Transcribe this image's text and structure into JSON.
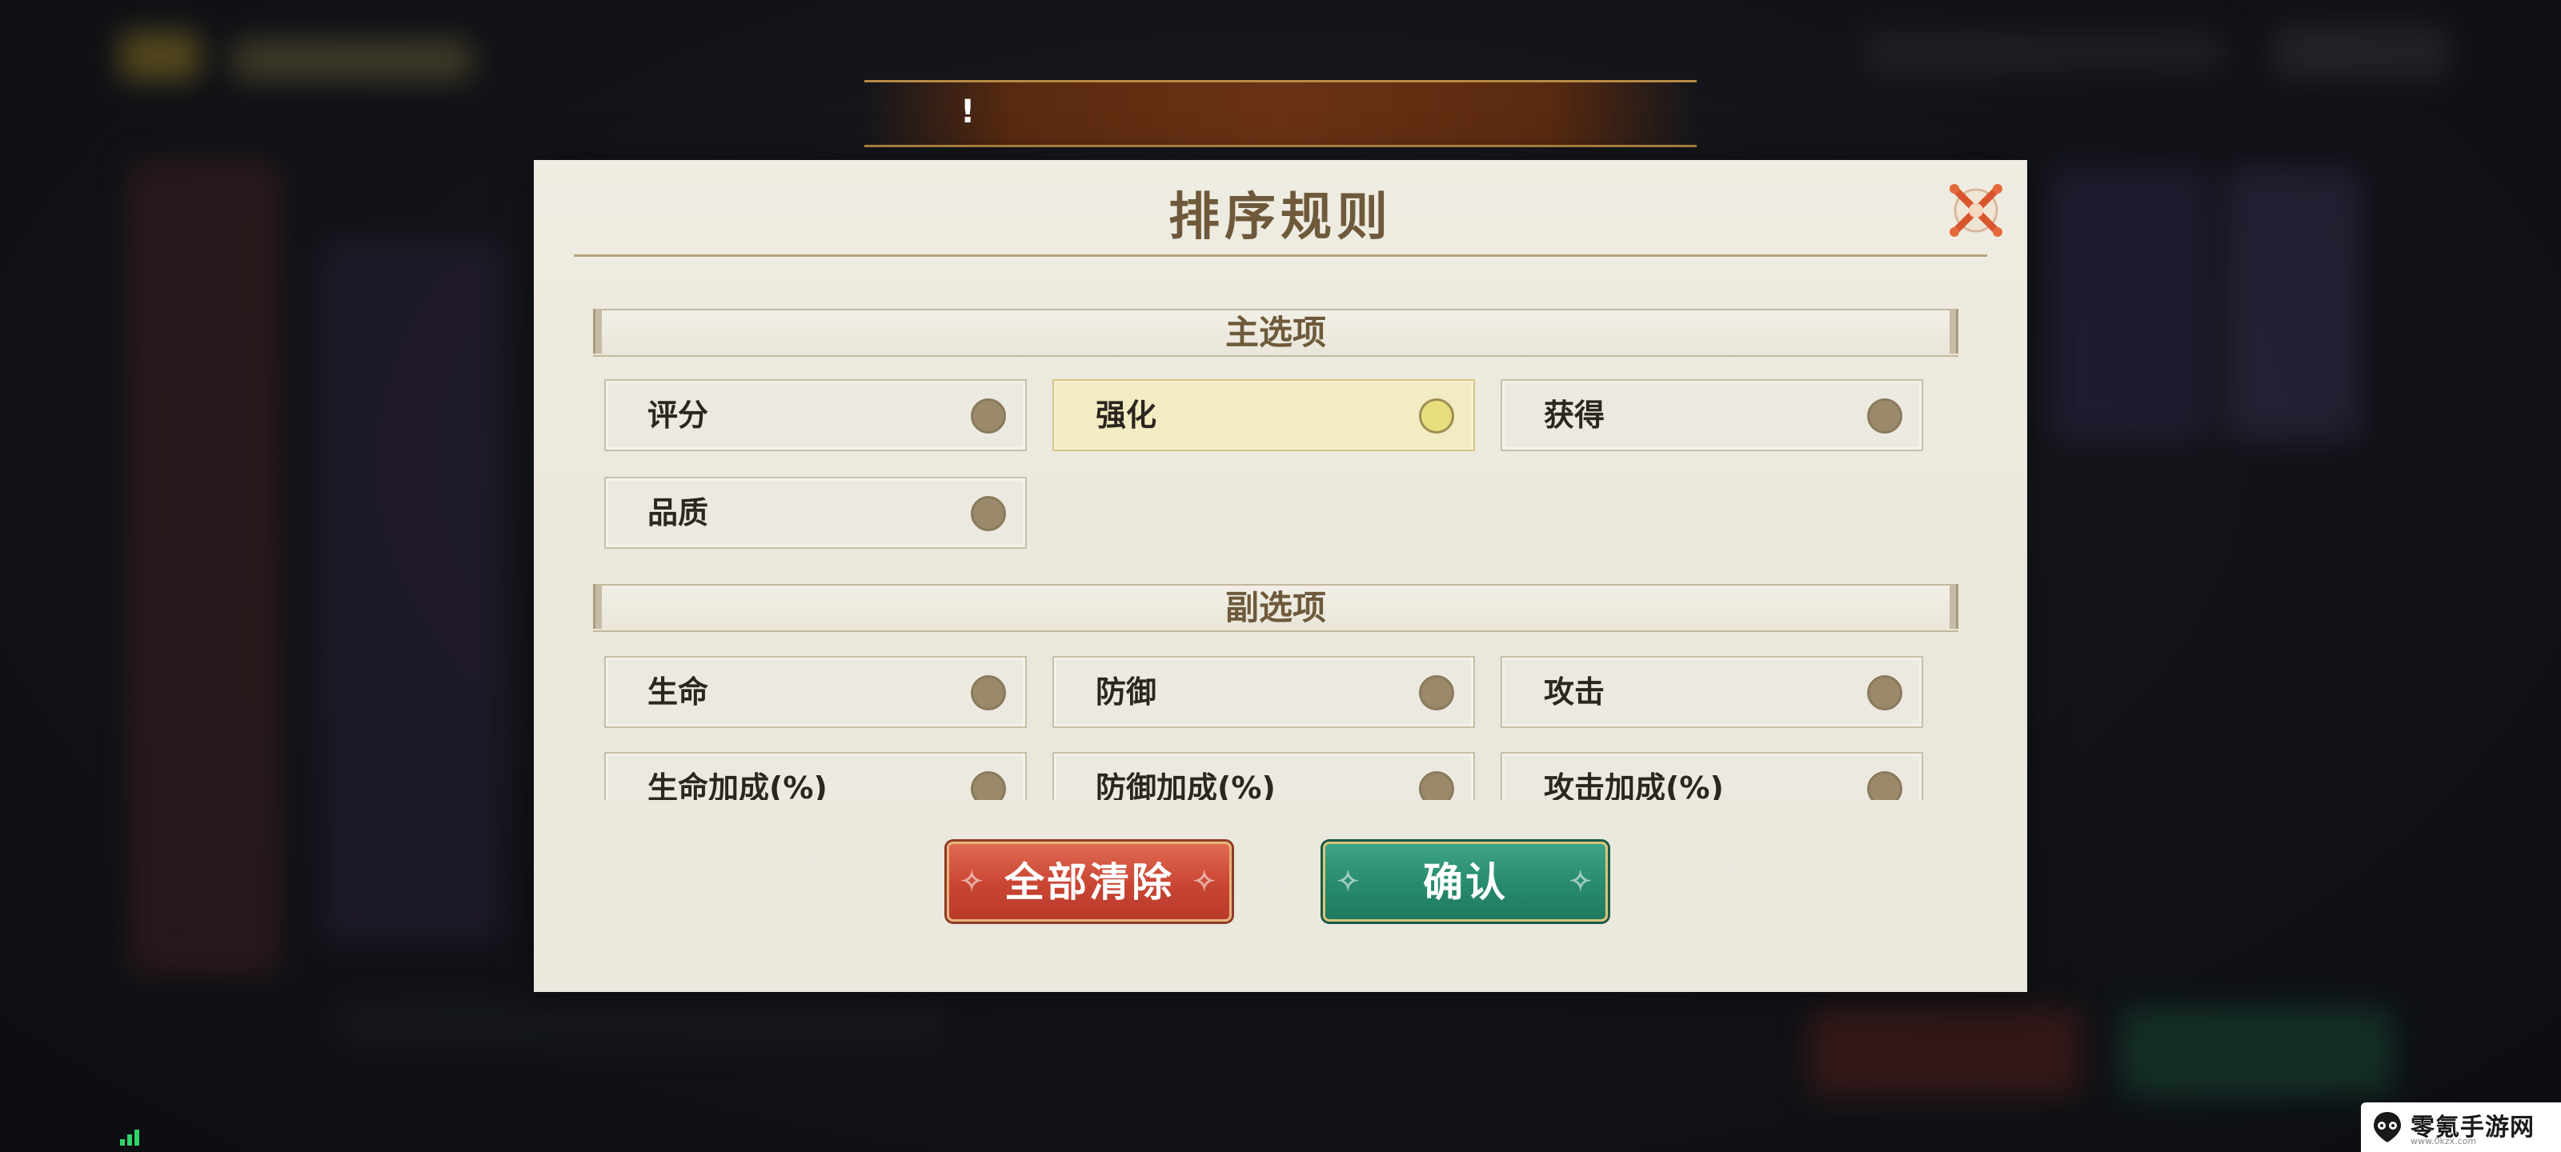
{
  "dialog": {
    "title": "排序规则",
    "close_icon": "close-x-icon",
    "primary": {
      "header": "主选项",
      "options": [
        {
          "label": "评分",
          "selected": false
        },
        {
          "label": "强化",
          "selected": true
        },
        {
          "label": "获得",
          "selected": false
        },
        {
          "label": "品质",
          "selected": false
        }
      ]
    },
    "secondary": {
      "header": "副选项",
      "options": [
        {
          "label": "生命",
          "selected": false
        },
        {
          "label": "防御",
          "selected": false
        },
        {
          "label": "攻击",
          "selected": false
        },
        {
          "label": "生命加成(%)",
          "selected": false
        },
        {
          "label": "防御加成(%)",
          "selected": false
        },
        {
          "label": "攻击加成(%)",
          "selected": false
        }
      ]
    },
    "buttons": {
      "clear_all": "全部清除",
      "confirm": "确认"
    }
  },
  "banner": {
    "mark": "!"
  },
  "watermark": {
    "text": "零氪手游网",
    "url": "www.0kzx.com"
  },
  "colors": {
    "accent_red": "#c94533",
    "accent_green": "#278a6d",
    "title_brown": "#6e5a3b",
    "selected_bg": "#f3ecc2"
  }
}
